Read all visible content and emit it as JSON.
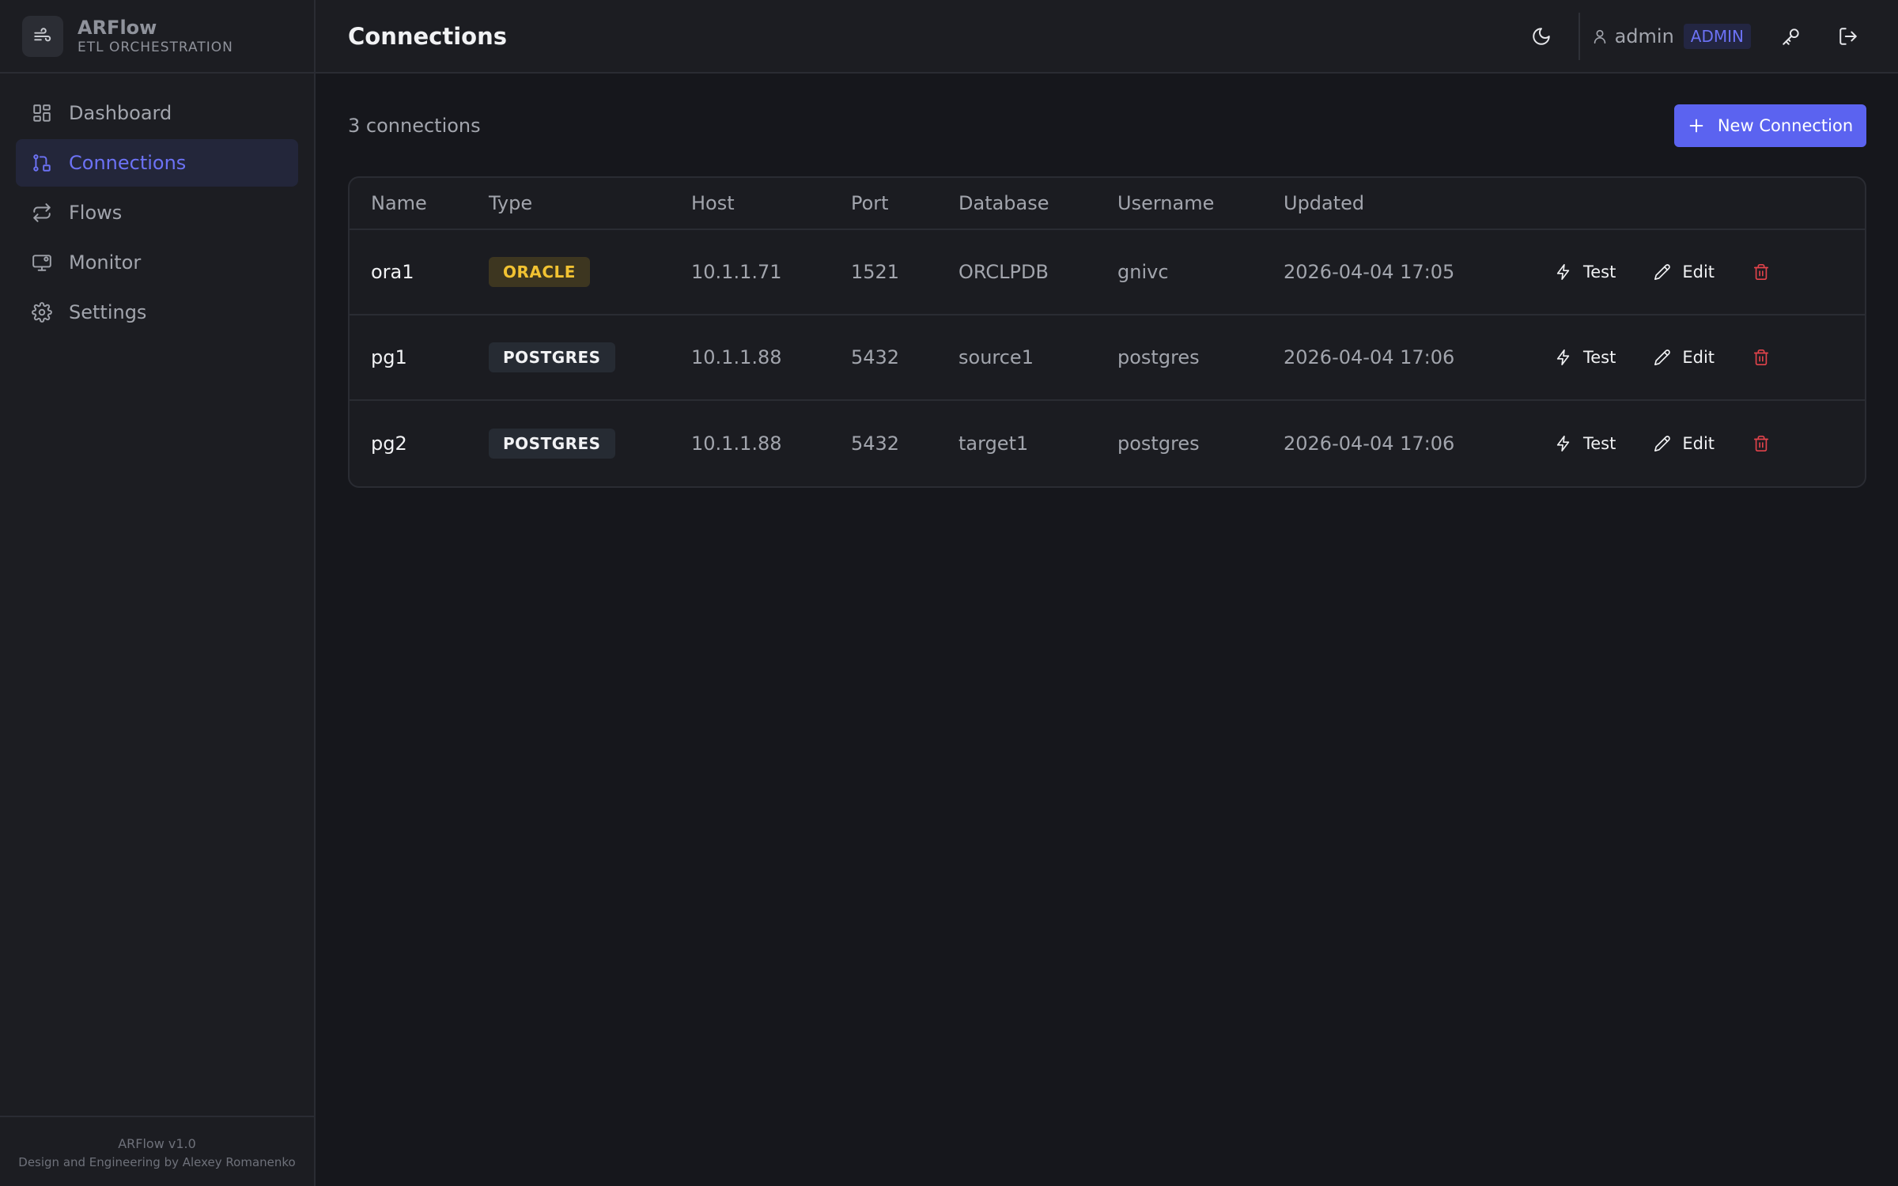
{
  "brand": {
    "name": "ARFlow",
    "subtitle": "ETL ORCHESTRATION"
  },
  "sidebar": {
    "items": [
      {
        "label": "Dashboard",
        "icon": "dashboard-icon",
        "active": false
      },
      {
        "label": "Connections",
        "icon": "connections-icon",
        "active": true
      },
      {
        "label": "Flows",
        "icon": "flows-icon",
        "active": false
      },
      {
        "label": "Monitor",
        "icon": "monitor-icon",
        "active": false
      },
      {
        "label": "Settings",
        "icon": "settings-icon",
        "active": false
      }
    ],
    "footer": {
      "version": "ARFlow v1.0",
      "credit": "Design and Engineering by Alexey Romanenko"
    }
  },
  "header": {
    "title": "Connections",
    "user": {
      "name": "admin",
      "role": "ADMIN"
    }
  },
  "main": {
    "count_text": "3 connections",
    "new_button_label": "New Connection",
    "columns": [
      "Name",
      "Type",
      "Host",
      "Port",
      "Database",
      "Username",
      "Updated"
    ],
    "actions": {
      "test": "Test",
      "edit": "Edit"
    },
    "rows": [
      {
        "name": "ora1",
        "type": "ORACLE",
        "host": "10.1.1.71",
        "port": "1521",
        "database": "ORCLPDB",
        "username": "gnivc",
        "updated": "2026-04-04 17:05"
      },
      {
        "name": "pg1",
        "type": "POSTGRES",
        "host": "10.1.1.88",
        "port": "5432",
        "database": "source1",
        "username": "postgres",
        "updated": "2026-04-04 17:06"
      },
      {
        "name": "pg2",
        "type": "POSTGRES",
        "host": "10.1.1.88",
        "port": "5432",
        "database": "target1",
        "username": "postgres",
        "updated": "2026-04-04 17:06"
      }
    ]
  },
  "colors": {
    "accent": "#5b63f0",
    "oracle": "#f1c232",
    "danger": "#e2434b",
    "background": "#16171c"
  }
}
